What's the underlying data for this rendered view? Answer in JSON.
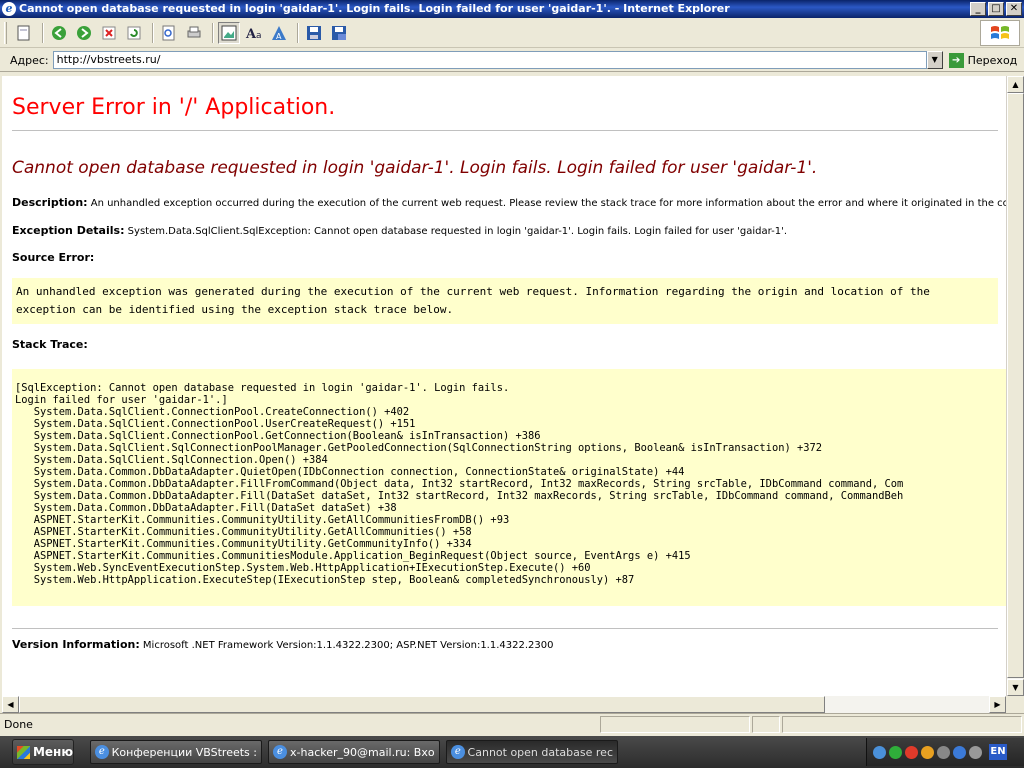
{
  "window": {
    "title": "Cannot open database requested in login 'gaidar-1'. Login fails. Login failed for user 'gaidar-1'. - Internet Explorer",
    "minimize": "_",
    "maximize": "□",
    "close": "✕"
  },
  "address": {
    "label": "Адрес:",
    "url": "http://vbstreets.ru/",
    "go_label": "Переход"
  },
  "page": {
    "title": "Server Error in '/' Application.",
    "message": "Cannot open database requested in login 'gaidar-1'. Login fails. Login failed for user 'gaidar-1'.",
    "description_label": "Description:",
    "description_text": "An unhandled exception occurred during the execution of the current web request. Please review the stack trace for more information about the error and where it originated in the code.",
    "exception_label": "Exception Details:",
    "exception_text": "System.Data.SqlClient.SqlException: Cannot open database requested in login 'gaidar-1'. Login fails. Login failed for user 'gaidar-1'.",
    "source_error_label": "Source Error:",
    "source_error_text": "An unhandled exception was generated during the execution of the current web request. Information regarding the origin and location of the exception can be identified using the exception stack trace below.",
    "stack_trace_label": "Stack Trace:",
    "stack_trace": "[SqlException: Cannot open database requested in login 'gaidar-1'. Login fails.\nLogin failed for user 'gaidar-1'.]\n   System.Data.SqlClient.ConnectionPool.CreateConnection() +402\n   System.Data.SqlClient.ConnectionPool.UserCreateRequest() +151\n   System.Data.SqlClient.ConnectionPool.GetConnection(Boolean& isInTransaction) +386\n   System.Data.SqlClient.SqlConnectionPoolManager.GetPooledConnection(SqlConnectionString options, Boolean& isInTransaction) +372\n   System.Data.SqlClient.SqlConnection.Open() +384\n   System.Data.Common.DbDataAdapter.QuietOpen(IDbConnection connection, ConnectionState& originalState) +44\n   System.Data.Common.DbDataAdapter.FillFromCommand(Object data, Int32 startRecord, Int32 maxRecords, String srcTable, IDbCommand command, Com\n   System.Data.Common.DbDataAdapter.Fill(DataSet dataSet, Int32 startRecord, Int32 maxRecords, String srcTable, IDbCommand command, CommandBeh\n   System.Data.Common.DbDataAdapter.Fill(DataSet dataSet) +38\n   ASPNET.StarterKit.Communities.CommunityUtility.GetAllCommunitiesFromDB() +93\n   ASPNET.StarterKit.Communities.CommunityUtility.GetAllCommunities() +58\n   ASPNET.StarterKit.Communities.CommunityUtility.GetCommunityInfo() +334\n   ASPNET.StarterKit.Communities.CommunitiesModule.Application_BeginRequest(Object source, EventArgs e) +415\n   System.Web.SyncEventExecutionStep.System.Web.HttpApplication+IExecutionStep.Execute() +60\n   System.Web.HttpApplication.ExecuteStep(IExecutionStep step, Boolean& completedSynchronously) +87",
    "version_label": "Version Information:",
    "version_text": "Microsoft .NET Framework Version:1.1.4322.2300; ASP.NET Version:1.1.4322.2300"
  },
  "status": {
    "text": "Done"
  },
  "taskbar": {
    "start_label": "Меню",
    "tasks": [
      "Конференции VBStreets :",
      "x-hacker_90@mail.ru: Вхо",
      "Cannot open database rec"
    ],
    "lang": "EN"
  }
}
